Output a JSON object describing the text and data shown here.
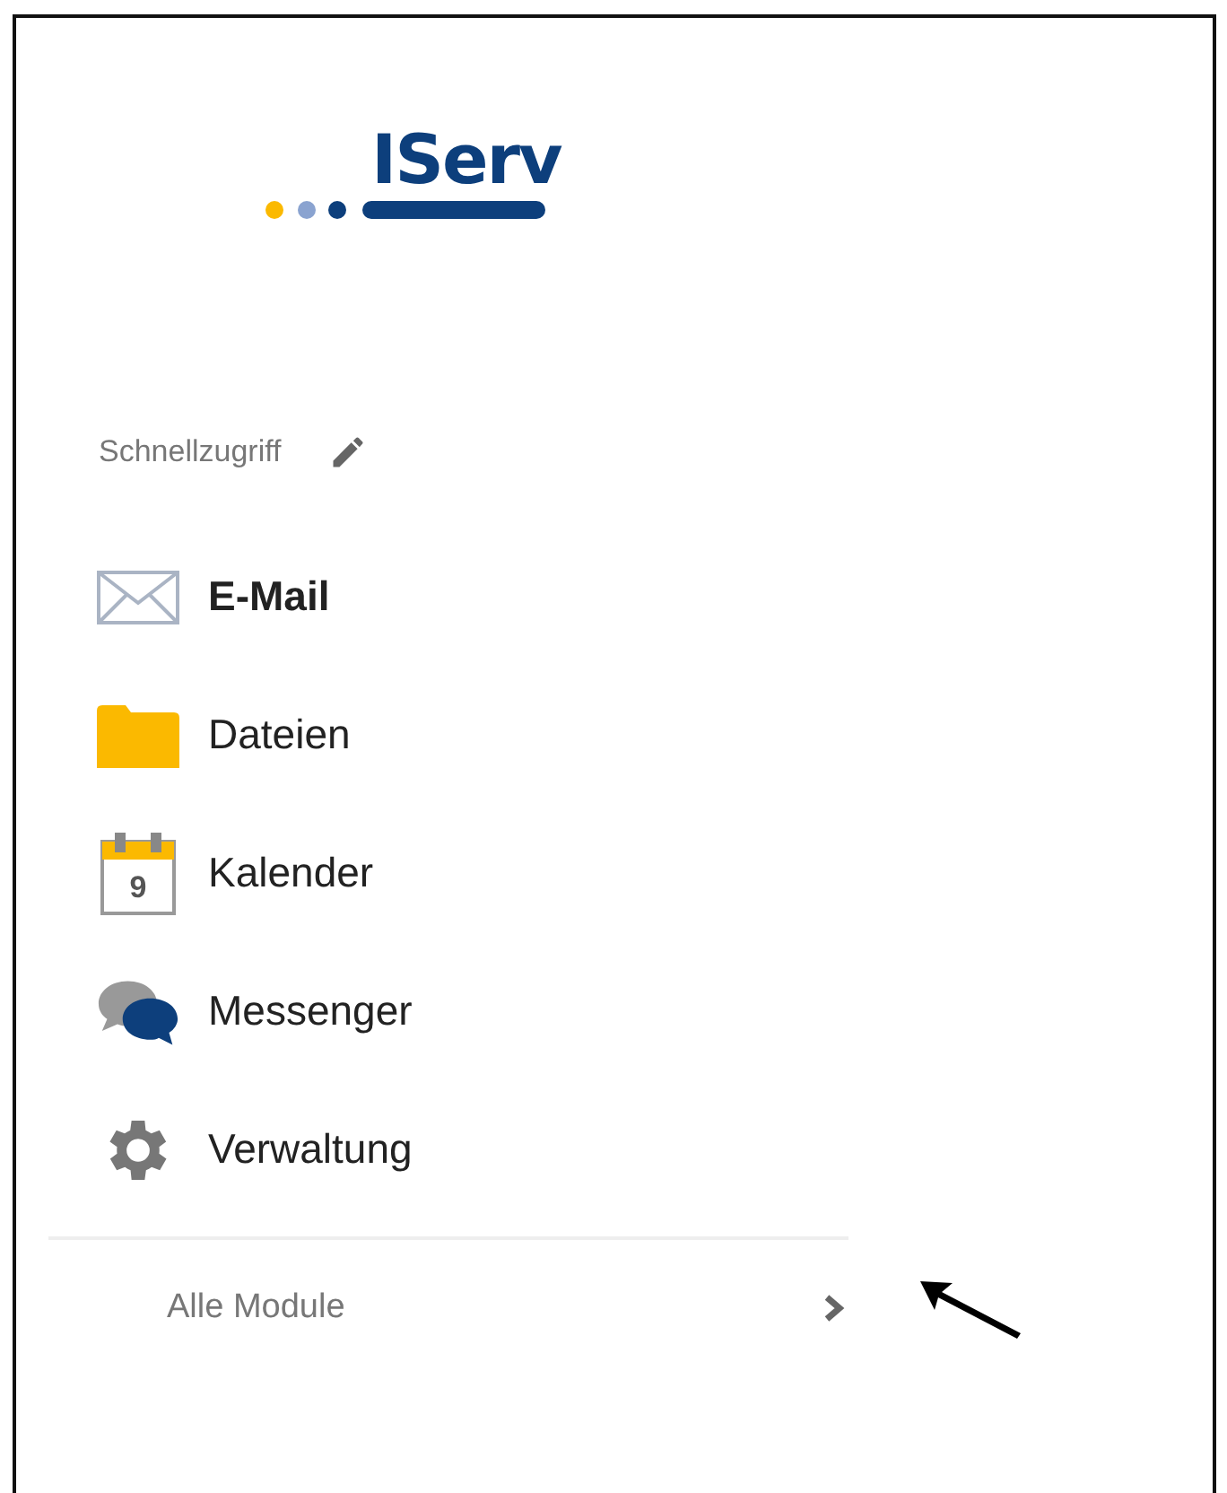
{
  "logo": {
    "text": "IServ"
  },
  "quick_access": {
    "title": "Schnellzugriff"
  },
  "items": [
    {
      "kind": "mail",
      "label": "E-Mail",
      "selected": true
    },
    {
      "kind": "folder",
      "label": "Dateien",
      "selected": false
    },
    {
      "kind": "calendar",
      "label": "Kalender",
      "selected": false,
      "icon_text": "9"
    },
    {
      "kind": "chat",
      "label": "Messenger",
      "selected": false
    },
    {
      "kind": "gear",
      "label": "Verwaltung",
      "selected": false
    }
  ],
  "all_modules": {
    "label": "Alle Module"
  }
}
